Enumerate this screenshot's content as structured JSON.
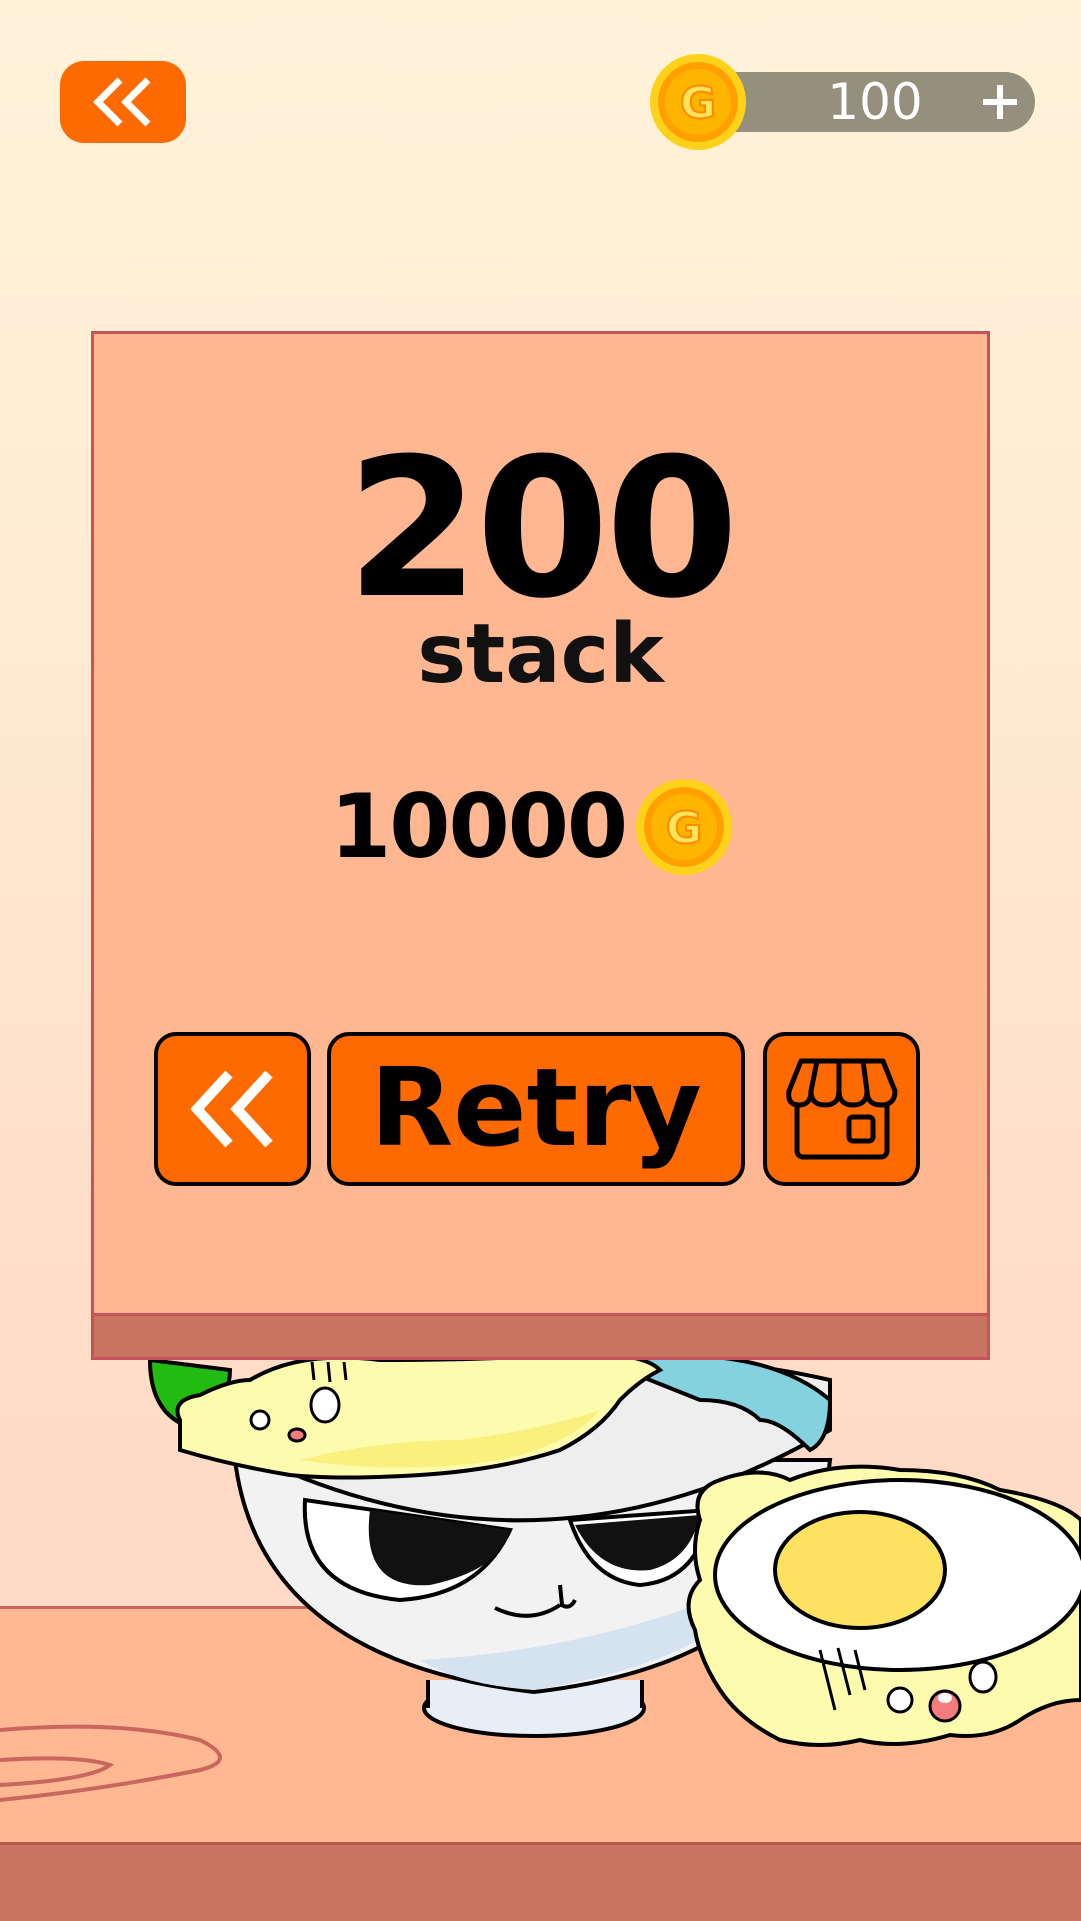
{
  "hud": {
    "back_icon": "double-chevron-left-icon",
    "coin_icon": "gold-coin-icon",
    "coin_letter": "G",
    "coin_balance": "100",
    "add_coins_icon": "plus-icon"
  },
  "result": {
    "score": "200",
    "score_unit": "stack",
    "reward_amount": "10000",
    "reward_icon": "gold-coin-icon",
    "coin_letter": "G"
  },
  "actions": {
    "back_icon": "double-chevron-left-icon",
    "retry_label": "Retry",
    "shop_icon": "shop-icon"
  },
  "colors": {
    "accent": "#ff6a00",
    "panel": "#ffb792",
    "coin": "#ffb400"
  }
}
